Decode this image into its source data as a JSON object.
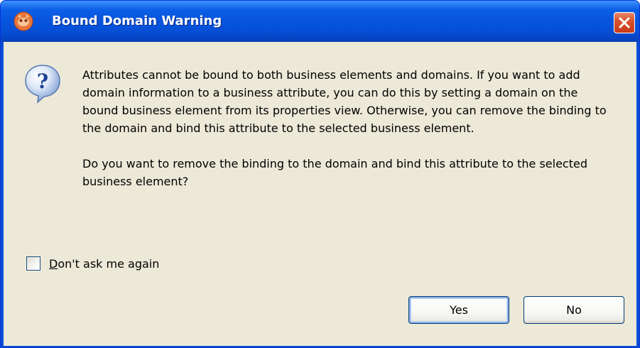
{
  "window": {
    "title": "Bound Domain Warning",
    "app_icon": "app-icon",
    "close_icon": "close-icon",
    "accent_color": "#0855dd",
    "close_color": "#d9532c"
  },
  "dialog": {
    "icon": "question-icon",
    "message_paragraph_1": "Attributes cannot be bound to both business elements and domains. If you want to add domain information to a business attribute, you can do this by setting a domain on the bound business element from its properties view. Otherwise, you can remove the binding to the domain and bind this attribute to the selected business element.",
    "message_paragraph_2": "Do you want to remove the binding to the domain and bind this attribute to the selected business element?",
    "checkbox": {
      "label_mnemonic": "D",
      "label_rest": "on't ask me again",
      "checked": false
    },
    "buttons": {
      "yes_label": "Yes",
      "no_label": "No"
    }
  }
}
